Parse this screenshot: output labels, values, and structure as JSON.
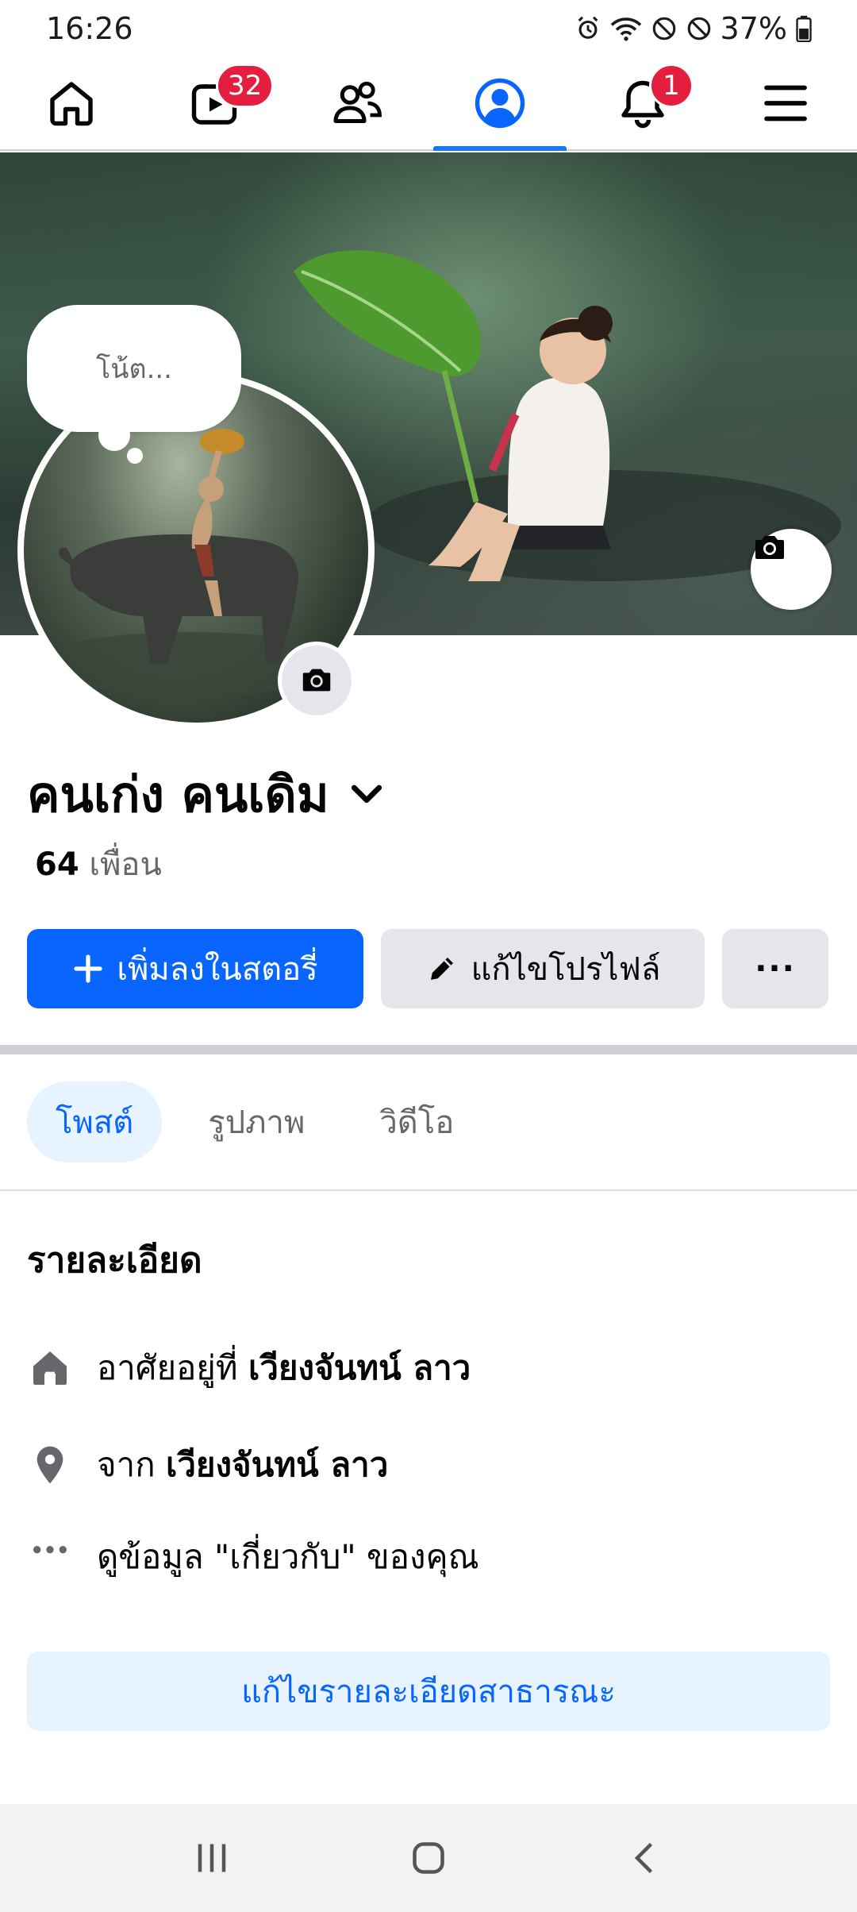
{
  "status_bar": {
    "time": "16:26",
    "battery": "37%"
  },
  "top_nav": {
    "items": [
      {
        "name": "home",
        "icon": "home-icon"
      },
      {
        "name": "video",
        "icon": "video-icon",
        "badge": "32"
      },
      {
        "name": "friends",
        "icon": "friends-icon"
      },
      {
        "name": "profile",
        "icon": "profile-icon",
        "active": true
      },
      {
        "name": "notifications",
        "icon": "bell-icon",
        "badge": "1"
      },
      {
        "name": "menu",
        "icon": "hamburger-icon"
      }
    ]
  },
  "note": {
    "placeholder": "โน้ต..."
  },
  "profile": {
    "name": "คนเก่ง คนเดิม",
    "friends_count": "64",
    "friends_label": "เพื่อน"
  },
  "actions": {
    "add_story": "เพิ่มลงในสตอรี่",
    "edit_profile": "แก้ไขโปรไฟล์",
    "more": "···"
  },
  "tabs": [
    {
      "label": "โพสต์",
      "active": true
    },
    {
      "label": "รูปภาพ",
      "active": false
    },
    {
      "label": "วิดีโอ",
      "active": false
    }
  ],
  "details": {
    "title": "รายละเอียด",
    "lives_in_prefix": "อาศัยอยู่ที่",
    "lives_in_place": "เวียงจันทน์ ลาว",
    "from_prefix": "จาก",
    "from_place": "เวียงจันทน์ ลาว",
    "about_link": "ดูข้อมูล \"เกี่ยวกับ\" ของคุณ",
    "edit_public": "แก้ไขรายละเอียดสาธารณะ"
  },
  "colors": {
    "accent": "#0866ff",
    "badge": "#e41e3f",
    "tab_bg": "#e7f3ff",
    "secondary_btn": "#e4e6eb"
  }
}
